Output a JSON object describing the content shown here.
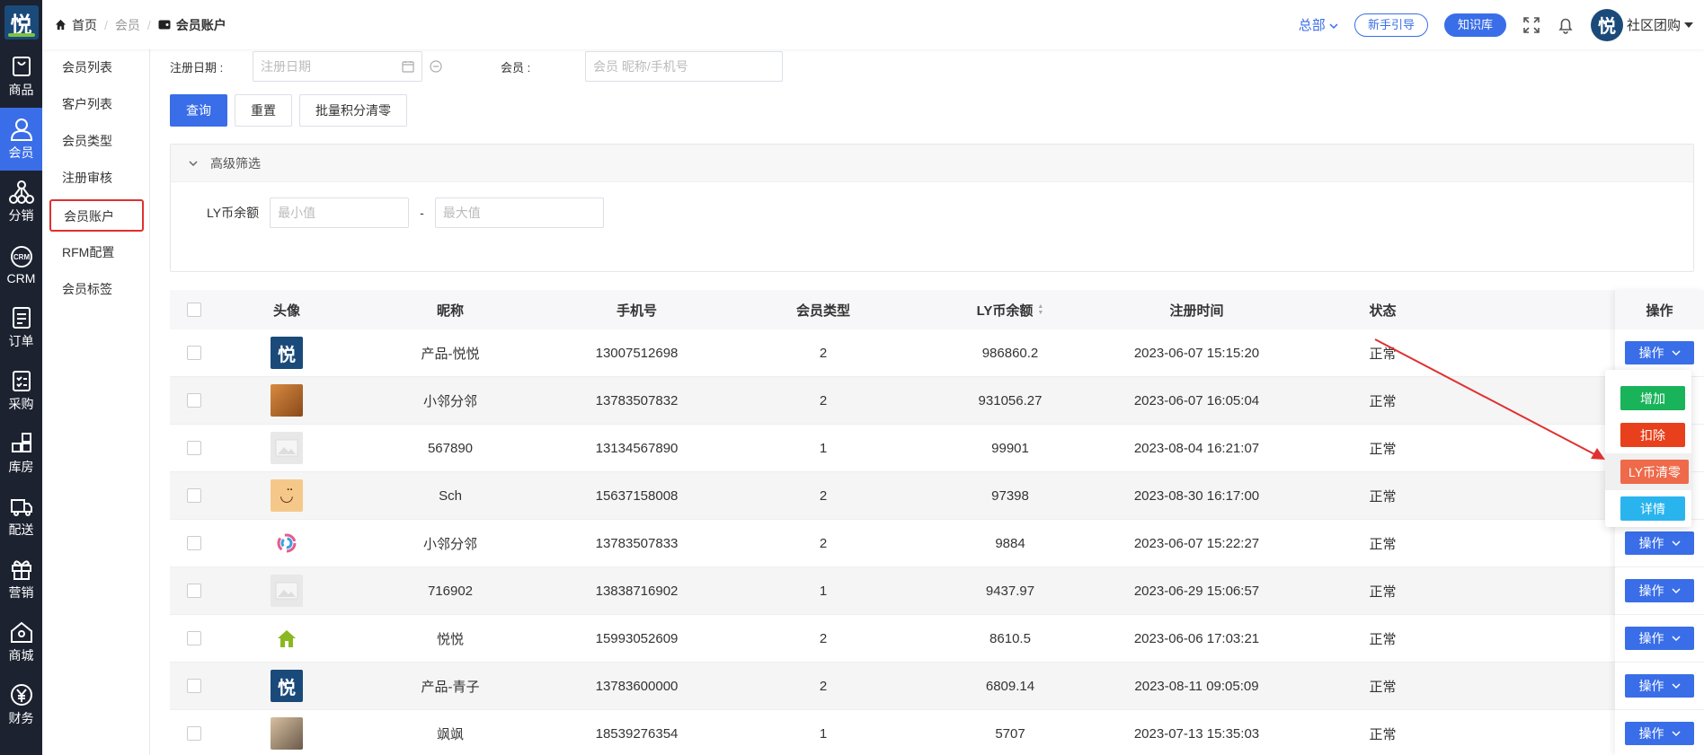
{
  "rail": {
    "logo": "悦",
    "items": [
      {
        "label": "商品",
        "icon": "bag-icon"
      },
      {
        "label": "会员",
        "icon": "user-icon",
        "active": true
      },
      {
        "label": "分销",
        "icon": "network-icon"
      },
      {
        "label": "CRM",
        "icon": "crm-icon"
      },
      {
        "label": "订单",
        "icon": "document-icon"
      },
      {
        "label": "采购",
        "icon": "checklist-icon"
      },
      {
        "label": "库房",
        "icon": "grid-icon"
      },
      {
        "label": "配送",
        "icon": "truck-icon"
      },
      {
        "label": "营销",
        "icon": "gift-icon"
      },
      {
        "label": "商城",
        "icon": "house-icon"
      },
      {
        "label": "财务",
        "icon": "yen-icon"
      }
    ]
  },
  "submenu": {
    "items": [
      {
        "label": "会员列表"
      },
      {
        "label": "客户列表"
      },
      {
        "label": "会员类型"
      },
      {
        "label": "注册审核"
      },
      {
        "label": "会员账户",
        "boxed": true
      },
      {
        "label": "RFM配置"
      },
      {
        "label": "会员标签"
      }
    ]
  },
  "header": {
    "breadcrumb": {
      "home": "首页",
      "parent": "会员",
      "current": "会员账户"
    },
    "region": "总部",
    "guide_btn": "新手引导",
    "kb_btn": "知识库",
    "user_name": "社区团购",
    "avatar_char": "悦"
  },
  "filters": {
    "reg_date_label": "注册日期 :",
    "reg_date_placeholder": "注册日期",
    "member_label": "会员 :",
    "member_placeholder": "会员 昵称/手机号",
    "query_btn": "查询",
    "reset_btn": "重置",
    "batch_btn": "批量积分清零",
    "advanced_title": "高级筛选",
    "ly_label": "LY币余额",
    "min_placeholder": "最小值",
    "range_sep": "-",
    "max_placeholder": "最大值"
  },
  "table": {
    "headers": [
      "头像",
      "昵称",
      "手机号",
      "会员类型",
      "LY币余额",
      "注册时间",
      "状态",
      "操作"
    ],
    "rows": [
      {
        "avatar": "logo",
        "nickname": "产品-悦悦",
        "phone": "13007512698",
        "type": "2",
        "balance": "986860.2",
        "time": "2023-06-07 15:15:20",
        "status": "正常"
      },
      {
        "avatar": "crate",
        "nickname": "小邻分邻",
        "phone": "13783507832",
        "type": "2",
        "balance": "931056.27",
        "time": "2023-06-07 16:05:04",
        "status": "正常"
      },
      {
        "avatar": "placeholder",
        "nickname": "567890",
        "phone": "13134567890",
        "type": "1",
        "balance": "99901",
        "time": "2023-08-04 16:21:07",
        "status": "正常"
      },
      {
        "avatar": "smile",
        "nickname": "Sch",
        "phone": "15637158008",
        "type": "2",
        "balance": "97398",
        "time": "2023-08-30 16:17:00",
        "status": "正常"
      },
      {
        "avatar": "swirl",
        "nickname": "小邻分邻",
        "phone": "13783507833",
        "type": "2",
        "balance": "9884",
        "time": "2023-06-07 15:22:27",
        "status": "正常"
      },
      {
        "avatar": "placeholder",
        "nickname": "716902",
        "phone": "13838716902",
        "type": "1",
        "balance": "9437.97",
        "time": "2023-06-29 15:06:57",
        "status": "正常"
      },
      {
        "avatar": "house",
        "nickname": "悦悦",
        "phone": "15993052609",
        "type": "2",
        "balance": "8610.5",
        "time": "2023-06-06 17:03:21",
        "status": "正常"
      },
      {
        "avatar": "logo",
        "nickname": "产品-青子",
        "phone": "13783600000",
        "type": "2",
        "balance": "6809.14",
        "time": "2023-08-11 09:05:09",
        "status": "正常"
      },
      {
        "avatar": "photo",
        "nickname": "飒飒",
        "phone": "18539276354",
        "type": "1",
        "balance": "5707",
        "time": "2023-07-13 15:35:03",
        "status": "正常"
      }
    ],
    "op_label": "操作"
  },
  "dropdown": {
    "add": "增加",
    "deduct": "扣除",
    "clear": "LY币清零",
    "detail": "详情"
  },
  "colors": {
    "accent": "#3a6ee8",
    "rail_bg": "#1c2230",
    "annotation_red": "#e03030"
  }
}
